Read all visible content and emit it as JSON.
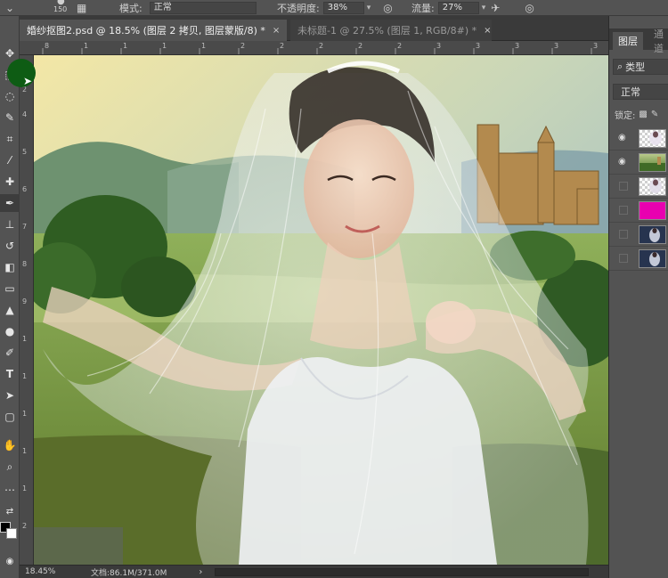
{
  "options_bar": {
    "brush_size": "150",
    "mode_label": "模式:",
    "mode_value": "正常",
    "opacity_label": "不透明度:",
    "opacity_value": "38%",
    "flow_label": "流量:",
    "flow_value": "27%"
  },
  "tabs": [
    {
      "label": "婚纱抠图2.psd @ 18.5% (图层 2 拷贝, 图层蒙版/8) *",
      "close": "×",
      "active": true
    },
    {
      "label": "未标题-1 @ 27.5% (图层 1, RGB/8#) *",
      "close": "×",
      "active": false
    }
  ],
  "ruler": {
    "top_labels": [
      "8",
      "1",
      "1",
      "1",
      "1",
      "2",
      "2",
      "2",
      "2",
      "2",
      "3",
      "3",
      "3",
      "3",
      "3"
    ],
    "left_labels": [
      "2",
      "4",
      "5",
      "6",
      "7",
      "8",
      "9",
      "1",
      "1",
      "1",
      "1",
      "1",
      "2"
    ]
  },
  "status": {
    "zoom": "18.45%",
    "document": "文档:86.1M/371.0M",
    "arrow": "›"
  },
  "layers_panel": {
    "tab_layers": "图层",
    "tab_channels": "通道",
    "filter_label": "类型",
    "blend_mode": "正常",
    "lock_label": "锁定:",
    "layers": [
      {
        "visible": true,
        "thumb": "checker-bride"
      },
      {
        "visible": true,
        "thumb": "landscape"
      },
      {
        "visible": false,
        "thumb": "checker-bride"
      },
      {
        "visible": false,
        "thumb": "magenta-fill",
        "color": "#e800b0"
      },
      {
        "visible": false,
        "thumb": "bride-dark"
      },
      {
        "visible": false,
        "thumb": "bride-dark"
      }
    ]
  },
  "colors": {
    "foreground": "#000000",
    "background": "#ffffff",
    "ui_dark": "#535353"
  },
  "tools": [
    "move-icon",
    "marquee-icon",
    "lasso-icon",
    "quick-select-icon",
    "crop-icon",
    "eyedropper-icon",
    "healing-icon",
    "brush-icon",
    "stamp-icon",
    "history-brush-icon",
    "eraser-icon",
    "gradient-icon",
    "blur-icon",
    "dodge-icon",
    "pen-icon",
    "type-icon",
    "path-select-icon",
    "shape-icon",
    "hand-icon",
    "zoom-icon",
    "more-icon"
  ],
  "tool_glyphs": {
    "type": "T"
  }
}
